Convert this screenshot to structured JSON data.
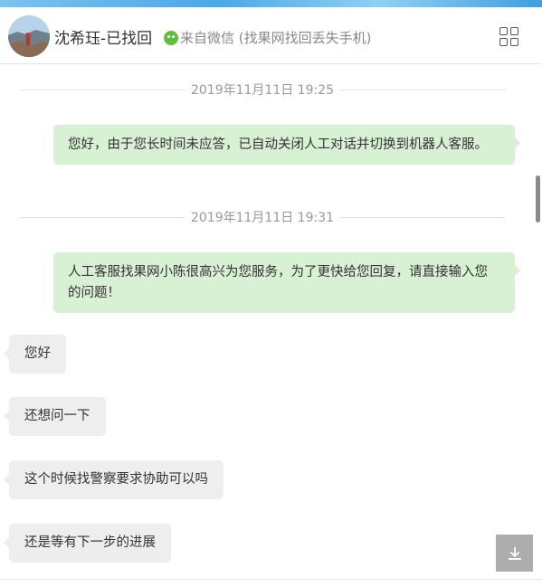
{
  "header": {
    "contact_name": "沈希珏-已找回",
    "source_icon": "wechat-icon",
    "source_text": "来自微信 (找果网找回丢失手机)",
    "menu_icon": "grid-icon"
  },
  "messages": {
    "dividers": [
      {
        "time": "2019年11月11日 19:25"
      },
      {
        "time": "2019年11月11日 19:31"
      }
    ],
    "outgoing": [
      {
        "text": "您好，由于您长时间未应答，已自动关闭人工对话并切换到机器人客服。"
      },
      {
        "text": "人工客服找果网小陈很高兴为您服务，为了更快给您回复，请直接输入您的问题！"
      }
    ],
    "incoming": [
      {
        "text": "您好"
      },
      {
        "text": "还想问一下"
      },
      {
        "text": "这个时候找警察要求协助可以吗"
      },
      {
        "text": "还是等有下一步的进展"
      }
    ]
  },
  "controls": {
    "scroll_down_icon": "download-arrow-icon"
  },
  "colors": {
    "outgoing_bubble": "#d8f0d3",
    "incoming_bubble": "#eeeeee",
    "wechat_green": "#5dbf3a",
    "timestamp": "#999999"
  }
}
